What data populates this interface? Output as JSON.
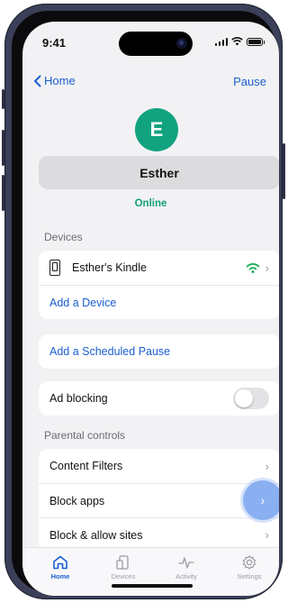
{
  "status_bar": {
    "time": "9:41"
  },
  "nav": {
    "back_label": "Home",
    "pause_label": "Pause"
  },
  "profile": {
    "initial": "E",
    "name": "Esther",
    "status": "Online"
  },
  "devices": {
    "section_title": "Devices",
    "items": [
      {
        "name": "Esther's Kindle",
        "icon": "tablet-icon",
        "connection_icon": "wifi-icon"
      }
    ],
    "add_label": "Add a Device"
  },
  "scheduled_pause": {
    "label": "Add a Scheduled Pause"
  },
  "ad_blocking": {
    "label": "Ad blocking",
    "enabled": false
  },
  "parental_controls": {
    "section_title": "Parental controls",
    "items": [
      {
        "label": "Content Filters"
      },
      {
        "label": "Block apps"
      },
      {
        "label": "Block & allow sites"
      }
    ]
  },
  "tabbar": {
    "items": [
      {
        "label": "Home",
        "icon": "home-icon",
        "active": true
      },
      {
        "label": "Devices",
        "icon": "devices-icon",
        "active": false
      },
      {
        "label": "Activity",
        "icon": "activity-icon",
        "active": false
      },
      {
        "label": "Settings",
        "icon": "settings-icon",
        "active": false
      }
    ]
  },
  "colors": {
    "accent": "#1b5ecf",
    "online": "#14a07a",
    "avatar": "#11a37f",
    "wifi": "#1ab05a",
    "fab": "#8ab0f2"
  }
}
